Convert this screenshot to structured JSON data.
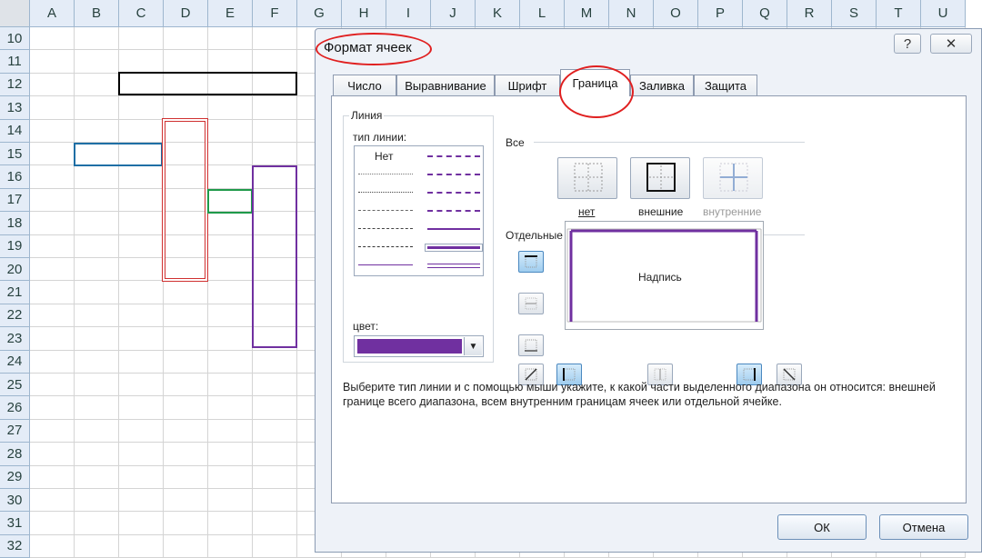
{
  "columns": [
    "A",
    "B",
    "C",
    "D",
    "E",
    "F",
    "G",
    "H",
    "I",
    "J",
    "K",
    "L",
    "M",
    "N",
    "O",
    "P",
    "Q",
    "R",
    "S",
    "T",
    "U"
  ],
  "rows": [
    "10",
    "11",
    "12",
    "13",
    "14",
    "15",
    "16",
    "17",
    "18",
    "19",
    "20",
    "21",
    "22",
    "23",
    "24",
    "25",
    "26",
    "27",
    "28",
    "29",
    "30",
    "31",
    "32"
  ],
  "dialog": {
    "title": "Формат ячеек",
    "help_icon": "?",
    "close_icon": "✕",
    "tabs": [
      "Число",
      "Выравнивание",
      "Шрифт",
      "Граница",
      "Заливка",
      "Защита"
    ],
    "active_tab": "Граница",
    "line_group": {
      "label": "Линия",
      "style_label": "тип линии:",
      "none_label": "Нет",
      "color_label": "цвет:",
      "color_value": "#7030a0"
    },
    "presets": {
      "label": "Все",
      "buttons": [
        "нет",
        "внешние",
        "внутренние"
      ]
    },
    "border_section": {
      "label": "Отдельные",
      "preview_text": "Надпись"
    },
    "description": "Выберите тип линии и с помощью мыши укажите, к какой части выделенного диапазона он относится: внешней границе всего диапазона, всем внутренним границам ячеек или отдельной ячейке.",
    "ok_label": "ОК",
    "cancel_label": "Отмена"
  },
  "colors": {
    "shape_black": "#000000",
    "shape_blue": "#1f6fa5",
    "shape_red": "#d03030",
    "shape_green": "#1f9a4a",
    "shape_purple": "#7030a0",
    "annotation_red": "#e02020"
  }
}
